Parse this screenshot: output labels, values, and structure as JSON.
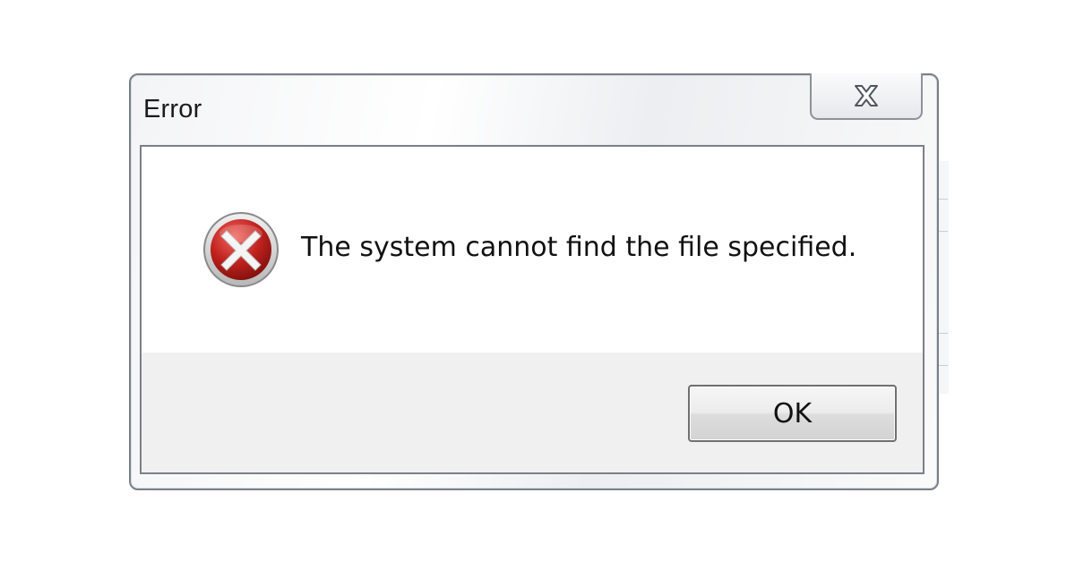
{
  "dialog": {
    "title": "Error",
    "message": "The system cannot find the file specified.",
    "ok_label": "OK",
    "close_icon": "close-icon",
    "status_icon": "error-icon"
  },
  "colors": {
    "error_red": "#c0221e",
    "frame": "#7a8089",
    "button_area": "#f0f0f0"
  }
}
